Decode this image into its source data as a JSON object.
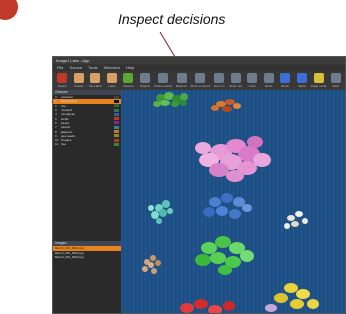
{
  "annotation": {
    "text": "Inspect decisions"
  },
  "window": {
    "title": "ImageJ Labs - App"
  },
  "menu": [
    "File",
    "Source",
    "Tools",
    "Selection",
    "Help"
  ],
  "toolbar": [
    {
      "label": "Detect",
      "color": "#c0392b"
    },
    {
      "label": "Cluster",
      "color": "#d9a066"
    },
    {
      "label": "Re-Label",
      "color": "#d9a066"
    },
    {
      "label": "Label",
      "color": "#d9a066"
    },
    {
      "label": "Classes",
      "color": "#5aa832"
    },
    {
      "label": "Objects",
      "color": "#6d7d8d"
    },
    {
      "label": "Model search",
      "color": "#6d7d8d"
    },
    {
      "label": "Balance",
      "color": "#6d7d8d"
    },
    {
      "label": "Show contours",
      "color": "#6d7d8d"
    },
    {
      "label": "Zoom in",
      "color": "#6d7d8d"
    },
    {
      "label": "Zoom out",
      "color": "#6d7d8d"
    },
    {
      "label": "Undo",
      "color": "#6d7d8d"
    },
    {
      "label": "Redo",
      "color": "#6d7d8d"
    },
    {
      "label": "Brush",
      "color": "#3b6fd6"
    },
    {
      "label": "Alpha",
      "color": "#3b6fd6"
    },
    {
      "label": "Edge mode",
      "color": "#d9c23a"
    },
    {
      "label": "Mark",
      "color": "#6d7d8d"
    }
  ],
  "classes": {
    "header": "Classes",
    "items": [
      {
        "idx": "0",
        "name": "unknown",
        "color": "#444444"
      },
      {
        "idx": "1",
        "name": "background",
        "color": "#111111",
        "selected": true
      },
      {
        "idx": "2",
        "name": "rice",
        "color": "#2c6a2c"
      },
      {
        "idx": "3",
        "name": "mustard",
        "color": "#2c7a5a"
      },
      {
        "idx": "4",
        "name": "mungbean",
        "color": "#2b5fa8"
      },
      {
        "idx": "5",
        "name": "lentils",
        "color": "#c23a2a"
      },
      {
        "idx": "6",
        "name": "beans",
        "color": "#7a2c8a"
      },
      {
        "idx": "7",
        "name": "peanut",
        "color": "#2c8a8a"
      },
      {
        "idx": "8",
        "name": "jalapeno",
        "color": "#c77a2a"
      },
      {
        "idx": "9",
        "name": "pea seeds",
        "color": "#8a8a2a"
      },
      {
        "idx": "10",
        "name": "Toapple",
        "color": "#a83c2a"
      },
      {
        "idx": "11",
        "name": "hue",
        "color": "#3a8a3a"
      }
    ]
  },
  "images": {
    "header": "Images",
    "items": [
      {
        "name": "Bench_001_0001.jpg",
        "selected": true
      },
      {
        "name": "Bench_001_0002.jpg"
      },
      {
        "name": "Bench_001_0003.jpg"
      }
    ]
  }
}
